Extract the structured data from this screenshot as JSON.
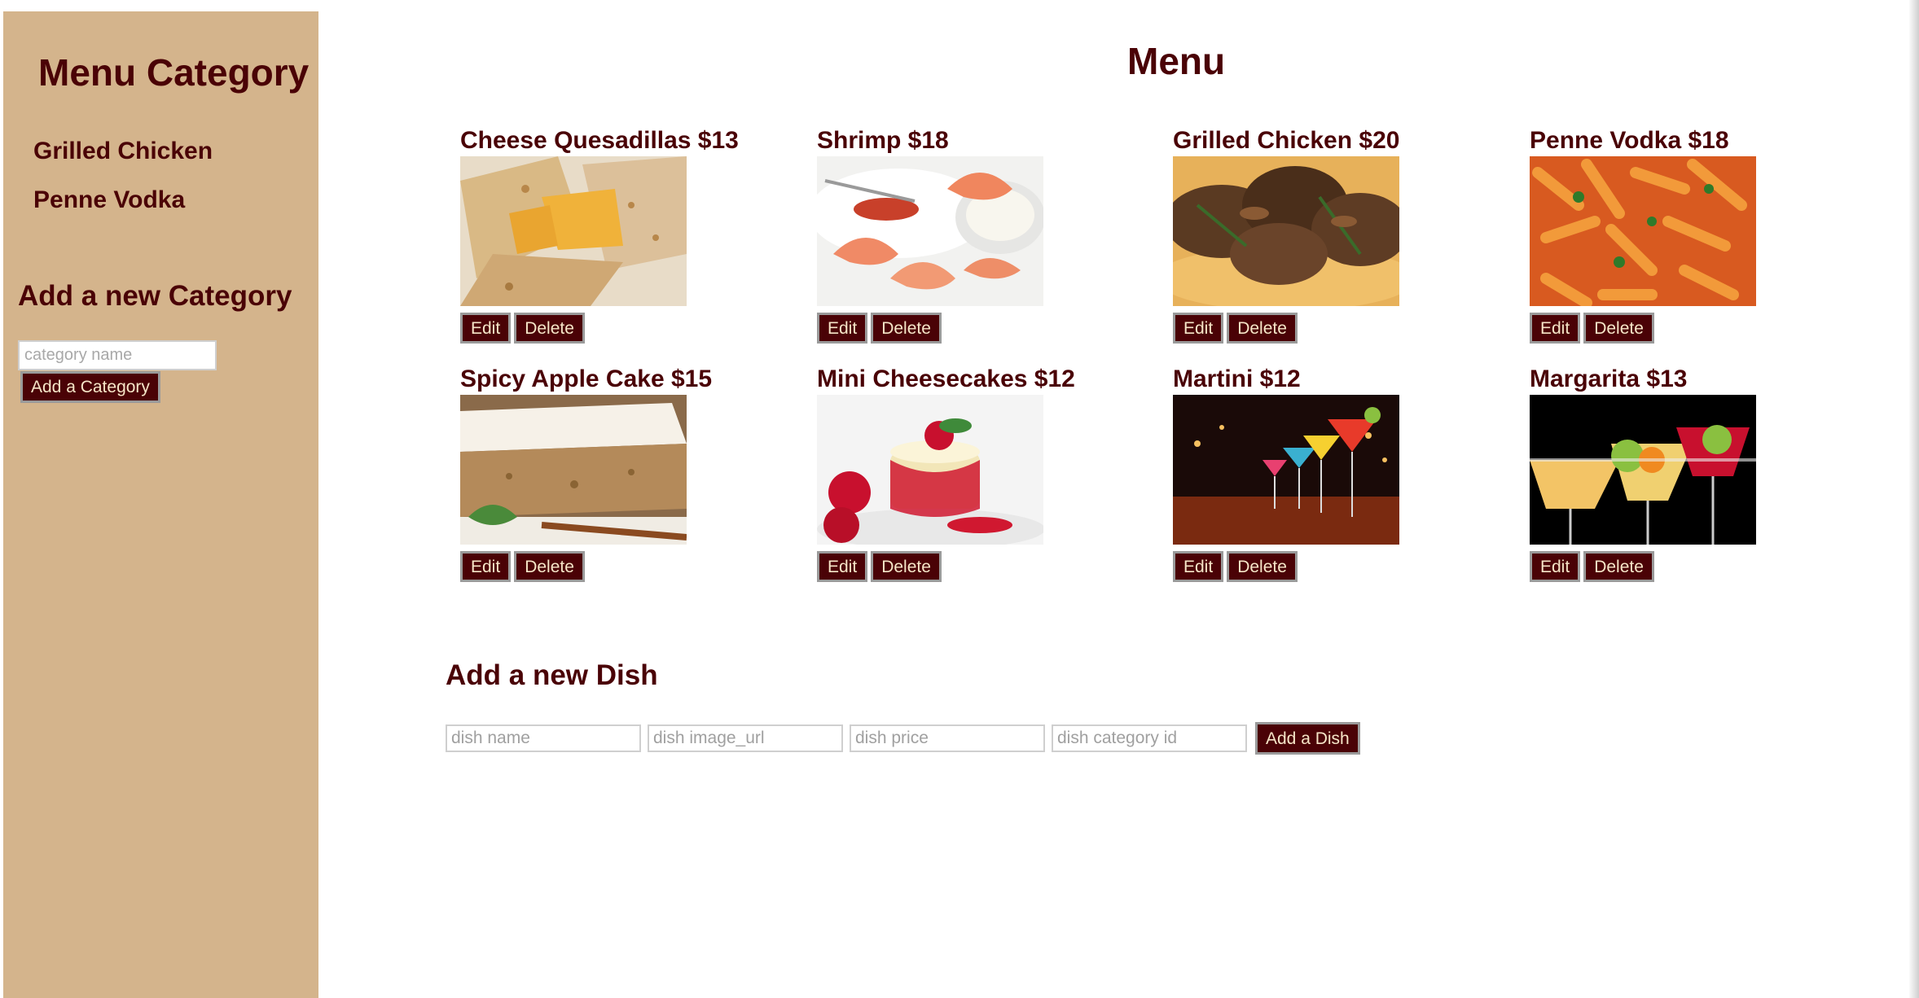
{
  "sidebar": {
    "title": "Menu Category",
    "categories": [
      {
        "label": "Grilled Chicken"
      },
      {
        "label": "Penne Vodka"
      }
    ],
    "add_title": "Add a new Category",
    "input_placeholder": "category name",
    "add_button": "Add a Category"
  },
  "main": {
    "title": "Menu",
    "dishes": [
      {
        "name": "Cheese Quesadillas $13",
        "edit": "Edit",
        "delete": "Delete"
      },
      {
        "name": "Shrimp $18",
        "edit": "Edit",
        "delete": "Delete"
      },
      {
        "name": "Grilled Chicken $20",
        "edit": "Edit",
        "delete": "Delete"
      },
      {
        "name": "Penne Vodka $18",
        "edit": "Edit",
        "delete": "Delete"
      },
      {
        "name": "Spicy Apple Cake $15",
        "edit": "Edit",
        "delete": "Delete"
      },
      {
        "name": "Mini Cheesecakes $12",
        "edit": "Edit",
        "delete": "Delete"
      },
      {
        "name": "Martini $12",
        "edit": "Edit",
        "delete": "Delete"
      },
      {
        "name": "Margarita $13",
        "edit": "Edit",
        "delete": "Delete"
      }
    ],
    "new_dish": {
      "title": "Add a new Dish",
      "name_placeholder": "dish name",
      "image_placeholder": "dish image_url",
      "price_placeholder": "dish price",
      "category_placeholder": "dish category id",
      "add_button": "Add a Dish"
    }
  },
  "colors": {
    "sidebar_bg": "#d4b48c",
    "text_maroon": "#4a0206",
    "button_bg": "#4a0206",
    "button_text": "#f6e6c8"
  }
}
